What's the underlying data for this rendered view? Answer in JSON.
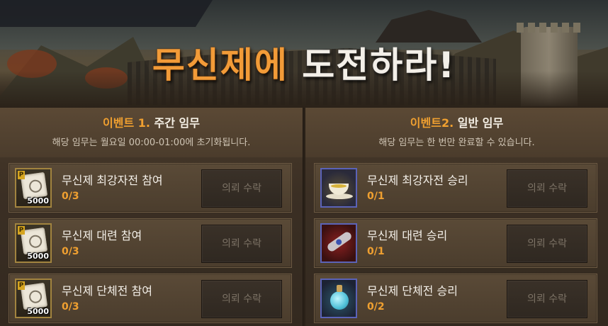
{
  "banner": {
    "title_part1": "무신제에",
    "title_part2": "도전하라!"
  },
  "events": [
    {
      "prefix": "이벤트 1.",
      "title": "주간 임무",
      "subtitle": "해당 임무는 월요일 00:00-01:00에 초기화됩니다.",
      "tasks": [
        {
          "icon": "point-scroll-icon",
          "amount": "5000",
          "name": "무신제 최강자전 참여",
          "progress": "0/3",
          "button": "의뢰 수락"
        },
        {
          "icon": "point-scroll-icon",
          "amount": "5000",
          "name": "무신제 대련 참여",
          "progress": "0/3",
          "button": "의뢰 수락"
        },
        {
          "icon": "point-scroll-icon",
          "amount": "5000",
          "name": "무신제 단체전 참여",
          "progress": "0/3",
          "button": "의뢰 수락"
        }
      ]
    },
    {
      "prefix": "이벤트2.",
      "title": "일반 임무",
      "subtitle": "해당 임무는 한 번만 완료할 수 있습니다.",
      "tasks": [
        {
          "icon": "tea-cup-icon",
          "name": "무신제 최강자전 승리",
          "progress": "0/1",
          "button": "의뢰 수락"
        },
        {
          "icon": "red-scroll-icon",
          "name": "무신제 대련 승리",
          "progress": "0/1",
          "button": "의뢰 수락"
        },
        {
          "icon": "potion-icon",
          "name": "무신제 단체전 승리",
          "progress": "0/2",
          "button": "의뢰 수락"
        }
      ]
    }
  ],
  "colors": {
    "accent": "#f0a030",
    "title_orange": "#f29b38",
    "text_light": "#f3efe8",
    "button_text": "#7d7366"
  }
}
